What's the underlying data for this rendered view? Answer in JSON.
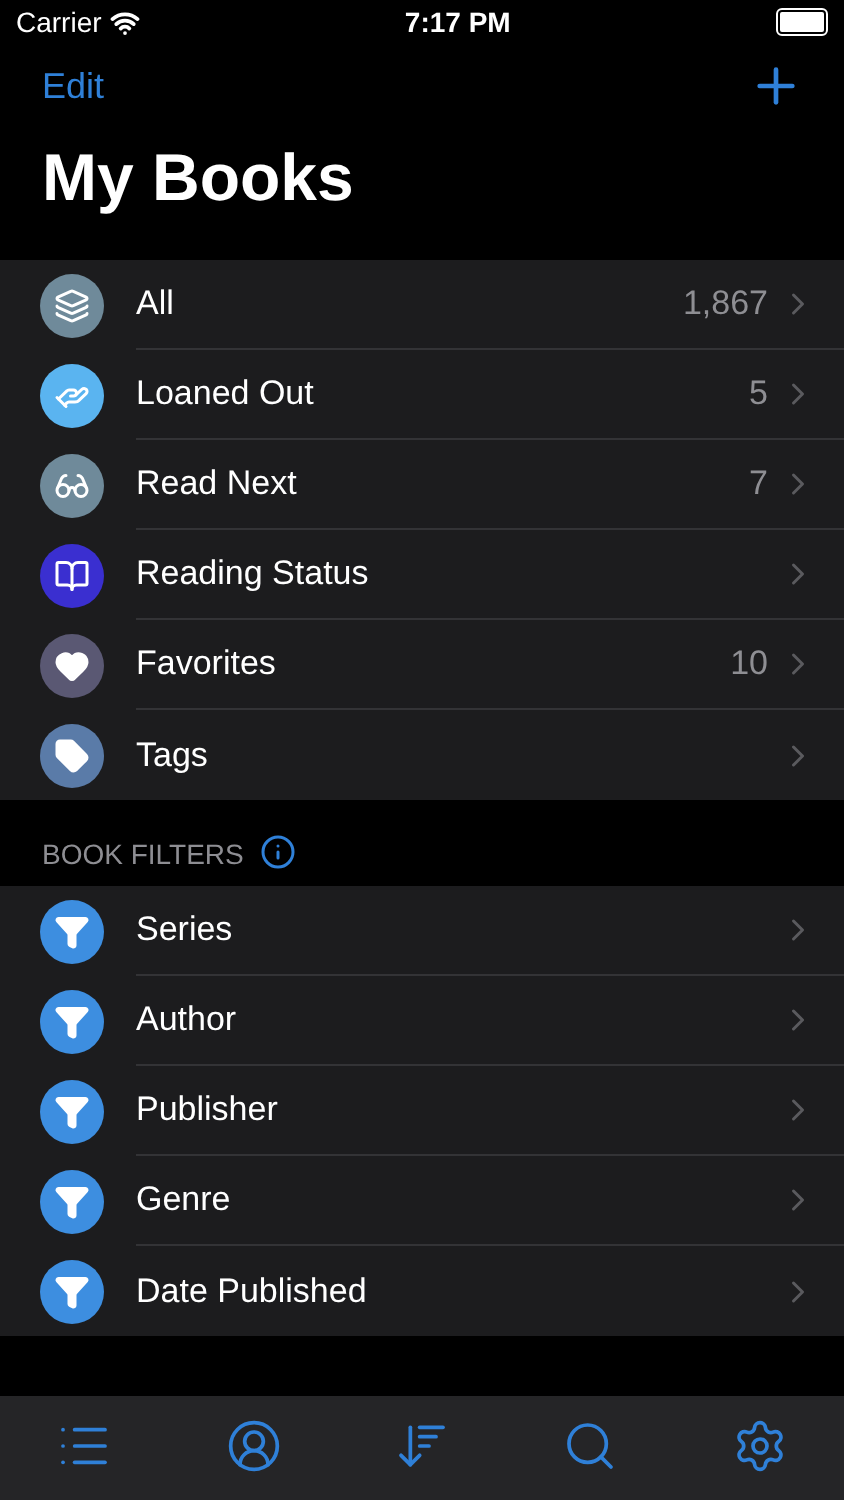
{
  "status_bar": {
    "carrier": "Carrier",
    "time": "7:17 PM"
  },
  "nav": {
    "edit": "Edit",
    "title": "My Books"
  },
  "library": [
    {
      "label": "All",
      "count": "1,867",
      "color": "#6f8a9a"
    },
    {
      "label": "Loaned Out",
      "count": "5",
      "color": "#5ab4f0"
    },
    {
      "label": "Read Next",
      "count": "7",
      "color": "#6f8a9a"
    },
    {
      "label": "Reading Status",
      "color": "#3a2fd0"
    },
    {
      "label": "Favorites",
      "count": "10",
      "color": "#5a5873"
    },
    {
      "label": "Tags",
      "color": "#5a7ba8"
    }
  ],
  "book_filters": {
    "header": "BOOK FILTERS",
    "items": [
      {
        "label": "Series",
        "color": "#3d8ee0"
      },
      {
        "label": "Author",
        "color": "#3d8ee0"
      },
      {
        "label": "Publisher",
        "color": "#3d8ee0"
      },
      {
        "label": "Genre",
        "color": "#3d8ee0"
      },
      {
        "label": "Date Published",
        "color": "#3d8ee0"
      }
    ]
  }
}
